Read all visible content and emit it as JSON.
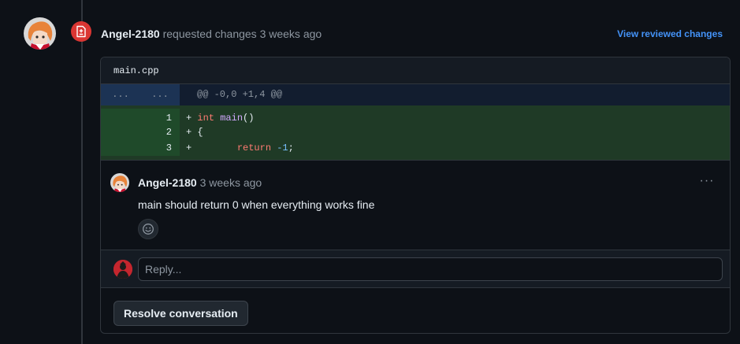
{
  "review": {
    "author": "Angel-2180",
    "action": "requested changes",
    "time": "3 weeks ago",
    "view_link": "View reviewed changes"
  },
  "file": {
    "name": "main.cpp"
  },
  "diff": {
    "hunk_old": "...",
    "hunk_new": "...",
    "hunk_header": "@@ -0,0 +1,4 @@",
    "lines": [
      {
        "num": "1",
        "sign": "+",
        "code_kw": "int",
        "code_fn": "main",
        "code_rest": "()"
      },
      {
        "num": "2",
        "sign": "+",
        "code_text": "{"
      },
      {
        "num": "3",
        "sign": "+",
        "code_kw": "return",
        "code_num": "-1",
        "code_rest": ";"
      }
    ]
  },
  "comment": {
    "author": "Angel-2180",
    "time": "3 weeks ago",
    "body": "main should return 0 when everything works fine",
    "menu": "···"
  },
  "reply": {
    "placeholder": "Reply..."
  },
  "actions": {
    "resolve_label": "Resolve conversation"
  },
  "colors": {
    "accent_link": "#4493f8",
    "changes_requested": "#da3633",
    "diff_add_bg": "#1f3a26",
    "hunk_bg": "#121d2f"
  }
}
